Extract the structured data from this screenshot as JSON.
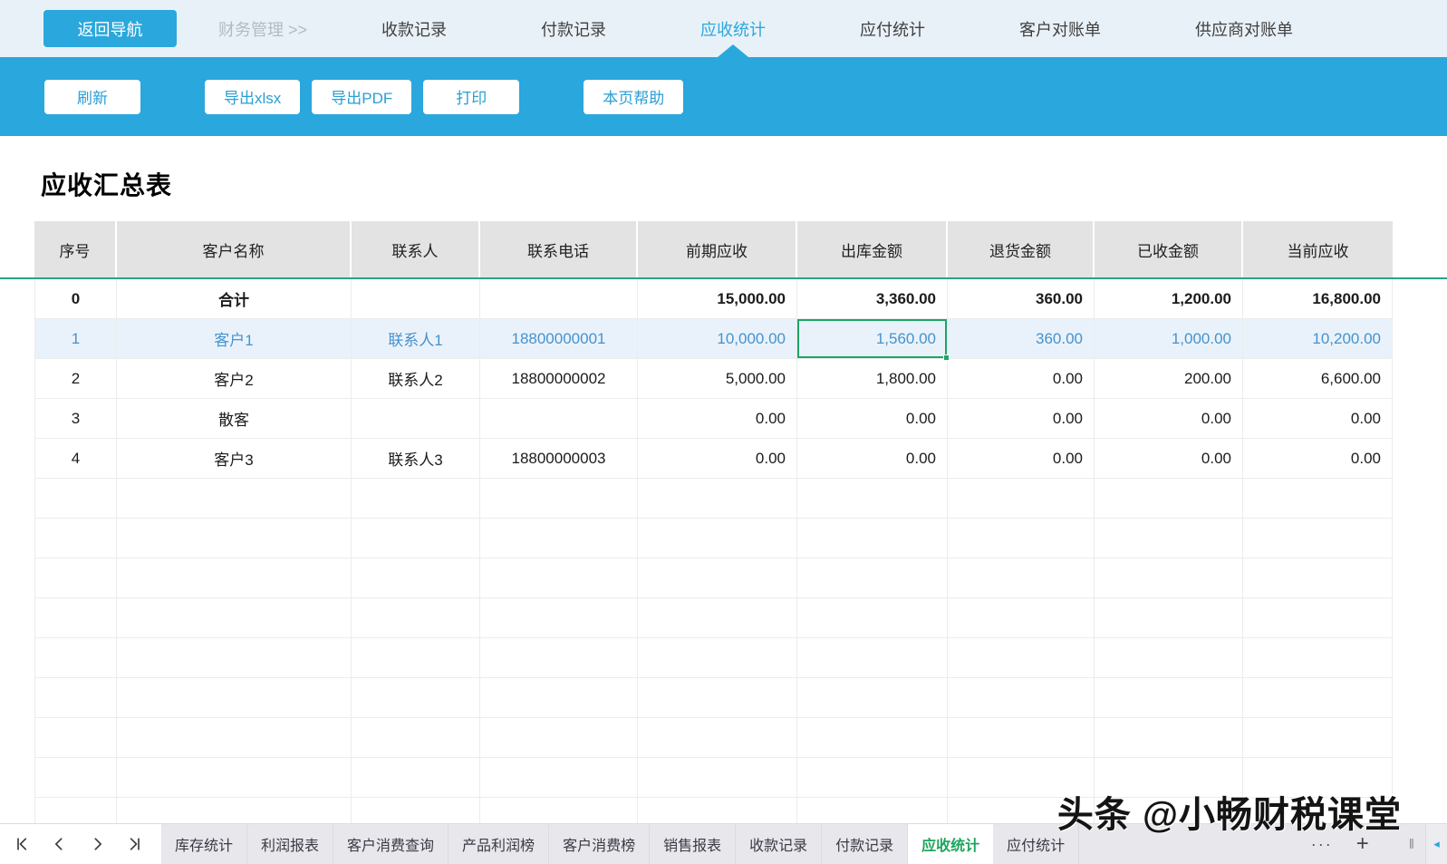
{
  "topnav": {
    "back_button": "返回导航",
    "breadcrumb": "财务管理 >>",
    "tabs": [
      "收款记录",
      "付款记录",
      "应收统计",
      "应付统计",
      "客户对账单",
      "供应商对账单"
    ],
    "active_tab": "应收统计"
  },
  "toolbar": {
    "buttons": [
      "刷新",
      "导出xlsx",
      "导出PDF",
      "打印",
      "本页帮助"
    ]
  },
  "page": {
    "title": "应收汇总表"
  },
  "table": {
    "columns": [
      "序号",
      "客户名称",
      "联系人",
      "联系电话",
      "前期应收",
      "出库金额",
      "退货金额",
      "已收金额",
      "当前应收"
    ],
    "rows": [
      {
        "cells": [
          "0",
          "合计",
          "",
          "",
          "15,000.00",
          "3,360.00",
          "360.00",
          "1,200.00",
          "16,800.00"
        ],
        "style": "total"
      },
      {
        "cells": [
          "1",
          "客户1",
          "联系人1",
          "18800000001",
          "10,000.00",
          "1,560.00",
          "360.00",
          "1,000.00",
          "10,200.00"
        ],
        "style": "selected",
        "selected_cell_index": 5
      },
      {
        "cells": [
          "2",
          "客户2",
          "联系人2",
          "18800000002",
          "5,000.00",
          "1,800.00",
          "0.00",
          "200.00",
          "6,600.00"
        ],
        "style": "normal"
      },
      {
        "cells": [
          "3",
          "散客",
          "",
          "",
          "0.00",
          "0.00",
          "0.00",
          "0.00",
          "0.00"
        ],
        "style": "normal"
      },
      {
        "cells": [
          "4",
          "客户3",
          "联系人3",
          "18800000003",
          "0.00",
          "0.00",
          "0.00",
          "0.00",
          "0.00"
        ],
        "style": "normal"
      }
    ],
    "empty_rows": 9
  },
  "sheetbar": {
    "nav_icons": [
      "first-page-icon",
      "prev-page-icon",
      "next-page-icon",
      "last-page-icon"
    ],
    "tabs": [
      "库存统计",
      "利润报表",
      "客户消费查询",
      "产品利润榜",
      "客户消费榜",
      "销售报表",
      "收款记录",
      "付款记录",
      "应收统计",
      "应付统计"
    ],
    "active_tab": "应收统计",
    "overflow_label": "···",
    "add_label": "+",
    "splitter_glyph": "‖",
    "scroll_left_glyph": "◂"
  },
  "watermark": {
    "text": "头条 @小畅财税课堂"
  },
  "colors": {
    "accent_blue": "#2aa7dc",
    "header_accent_teal": "#2ba18c",
    "selection_green": "#1ea566",
    "active_sheet_green": "#1fa45e",
    "selected_row_text_blue": "#4792cb"
  }
}
